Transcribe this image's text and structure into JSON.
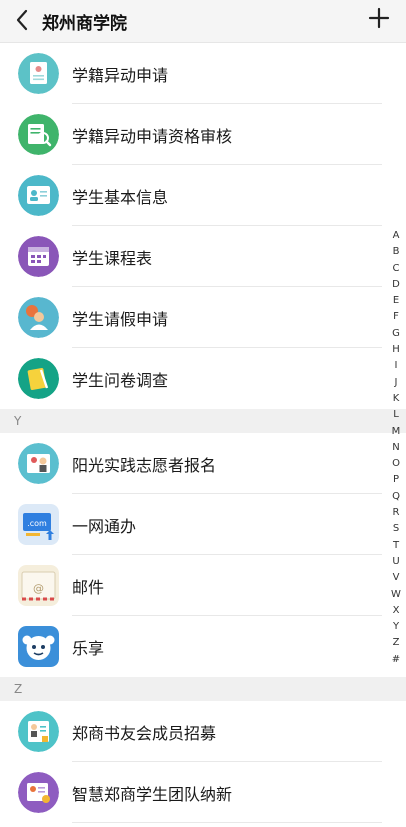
{
  "header": {
    "title": "郑州商学院"
  },
  "groups": [
    {
      "items": [
        {
          "label": "学籍异动申请",
          "icon": "student-status-change-icon",
          "color": "#5cc2c7"
        },
        {
          "label": "学籍异动申请资格审核",
          "icon": "qualification-review-icon",
          "color": "#3fb46b"
        },
        {
          "label": "学生基本信息",
          "icon": "student-info-icon",
          "color": "#4cb8c9"
        },
        {
          "label": "学生课程表",
          "icon": "timetable-icon",
          "color": "#8a56b8"
        },
        {
          "label": "学生请假申请",
          "icon": "leave-request-icon",
          "color": "#58b7cf"
        },
        {
          "label": "学生问卷调查",
          "icon": "survey-icon",
          "color": "#14a386"
        }
      ]
    },
    {
      "header": "Y",
      "items": [
        {
          "label": "阳光实践志愿者报名",
          "icon": "volunteer-signup-icon",
          "color": "#5bbfcf"
        },
        {
          "label": "一网通办",
          "icon": "online-service-icon",
          "color": "#dce9f7"
        },
        {
          "label": "邮件",
          "icon": "mail-icon",
          "color": "#f5eedc"
        },
        {
          "label": "乐享",
          "icon": "lexiang-icon",
          "color": "#3b8fd9"
        }
      ]
    },
    {
      "header": "Z",
      "items": [
        {
          "label": "郑商书友会成员招募",
          "icon": "book-club-icon",
          "color": "#4ec3c8"
        },
        {
          "label": "智慧郑商学生团队纳新",
          "icon": "team-recruit-icon",
          "color": "#8e5cc0"
        }
      ]
    }
  ],
  "index": [
    "A",
    "B",
    "C",
    "D",
    "E",
    "F",
    "G",
    "H",
    "I",
    "J",
    "K",
    "L",
    "M",
    "N",
    "O",
    "P",
    "Q",
    "R",
    "S",
    "T",
    "U",
    "V",
    "W",
    "X",
    "Y",
    "Z",
    "#"
  ]
}
